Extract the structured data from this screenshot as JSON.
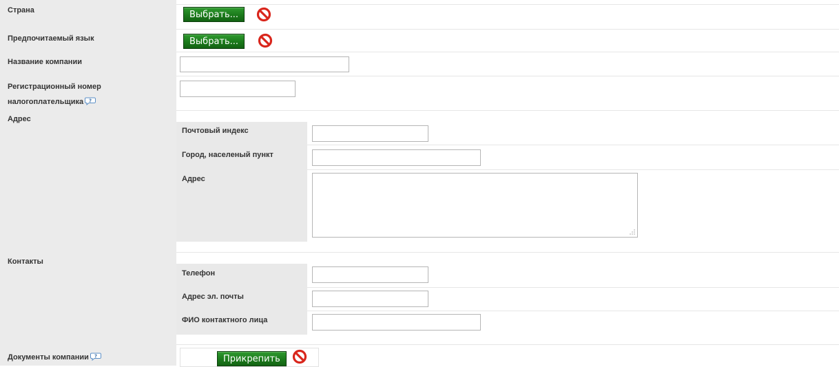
{
  "form": {
    "country": {
      "label": "Страна",
      "button": "Выбрать..."
    },
    "language": {
      "label": "Предпочитаемый язык",
      "button": "Выбрать..."
    },
    "company_name": {
      "label": "Название компании",
      "value": ""
    },
    "tax_id": {
      "label_line1": "Регистрационный номер",
      "label_line2": "налогоплательщика",
      "value": ""
    },
    "address": {
      "label": "Адрес",
      "postal_code": {
        "label": "Почтовый индекс",
        "value": ""
      },
      "city": {
        "label": "Город, населеный пункт",
        "value": ""
      },
      "street": {
        "label": "Адрес",
        "value": ""
      }
    },
    "contacts": {
      "label": "Контакты",
      "phone": {
        "label": "Телефон",
        "value": ""
      },
      "email": {
        "label": "Адрес эл. почты",
        "value": ""
      },
      "contact_person": {
        "label": "ФИО контактного лица",
        "value": ""
      }
    },
    "documents": {
      "label": "Документы компании",
      "button": "Прикрепить"
    }
  },
  "colors": {
    "button_green": "#1b7a1b",
    "clear_red": "#d9261c",
    "label_bg": "#ebebeb"
  },
  "icons": {
    "clear": "prohibited-icon",
    "help": "help-bubble-icon"
  }
}
